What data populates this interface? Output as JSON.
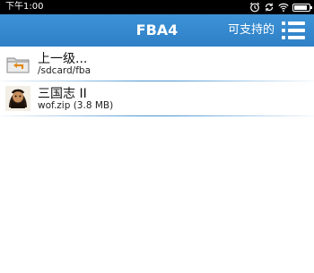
{
  "status_bar": {
    "time": "下午1:00",
    "icons": [
      "alarm-icon",
      "sync-icon",
      "wifi-icon",
      "battery-icon"
    ]
  },
  "header": {
    "title": "FBA4",
    "support_label": "可支持的",
    "menu_icon": "menu-icon",
    "color": "#2f80c6"
  },
  "files": [
    {
      "name": "上一级...",
      "detail": "/sdcard/fba",
      "icon": "folder-up-icon"
    },
    {
      "name": "三国志 II",
      "detail": "wof.zip  (3.8 MB)",
      "icon": "game-thumbnail-icon"
    }
  ]
}
